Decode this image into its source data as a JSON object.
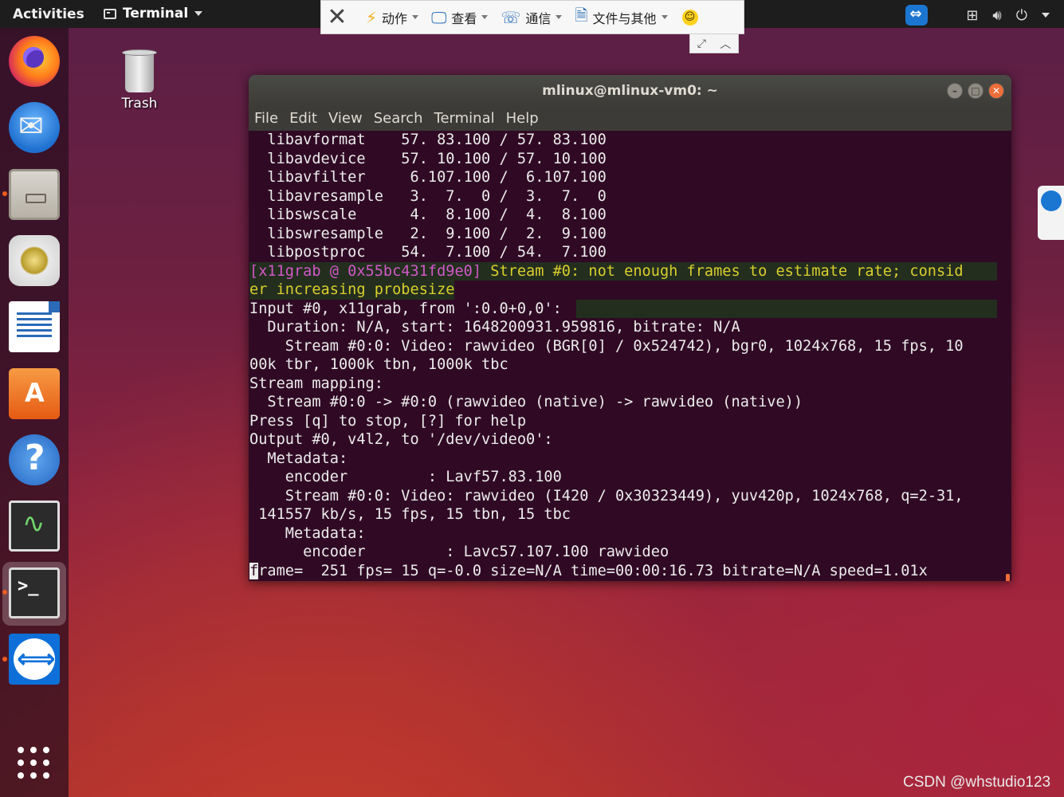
{
  "topbar": {
    "activities": "Activities",
    "app_menu": "Terminal"
  },
  "remote_toolbar": {
    "items": [
      {
        "label": "动作",
        "icon": "lightning-icon"
      },
      {
        "label": "查看",
        "icon": "monitor-icon"
      },
      {
        "label": "通信",
        "icon": "chat-icon"
      },
      {
        "label": "文件与其他",
        "icon": "file-transfer-icon"
      }
    ]
  },
  "desktop": {
    "trash_label": "Trash"
  },
  "terminal": {
    "title": "mlinux@mlinux-vm0: ~",
    "menu": [
      "File",
      "Edit",
      "View",
      "Search",
      "Terminal",
      "Help"
    ],
    "lines": [
      "  libavformat    57. 83.100 / 57. 83.100",
      "  libavdevice    57. 10.100 / 57. 10.100",
      "  libavfilter     6.107.100 /  6.107.100",
      "  libavresample   3.  7.  0 /  3.  7.  0",
      "  libswscale      4.  8.100 /  4.  8.100",
      "  libswresample   2.  9.100 /  2.  9.100",
      "  libpostproc    54.  7.100 / 54.  7.100",
      "[x11grab @ 0x55bc431fd9e0]",
      " Stream #0: not enough frames to estimate rate; consid",
      "er increasing probesize",
      "Input #0, x11grab, from ':0.0+0,0':",
      "  Duration: N/A, start: 1648200931.959816, bitrate: N/A",
      "    Stream #0:0: Video: rawvideo (BGR[0] / 0x524742), bgr0, 1024x768, 15 fps, 10",
      "00k tbr, 1000k tbn, 1000k tbc",
      "Stream mapping:",
      "  Stream #0:0 -> #0:0 (rawvideo (native) -> rawvideo (native))",
      "Press [q] to stop, [?] for help",
      "Output #0, v4l2, to '/dev/video0':",
      "  Metadata:",
      "    encoder         : Lavf57.83.100",
      "    Stream #0:0: Video: rawvideo (I420 / 0x30323449), yuv420p, 1024x768, q=2-31,",
      " 141557 kb/s, 15 fps, 15 tbn, 15 tbc",
      "    Metadata:",
      "      encoder         : Lavc57.107.100 rawvideo",
      "f",
      "rame=  251 fps= 15 q=-0.0 size=N/A time=00:00:16.73 bitrate=N/A speed=1.01x"
    ]
  },
  "watermark": "CSDN @whstudio123"
}
